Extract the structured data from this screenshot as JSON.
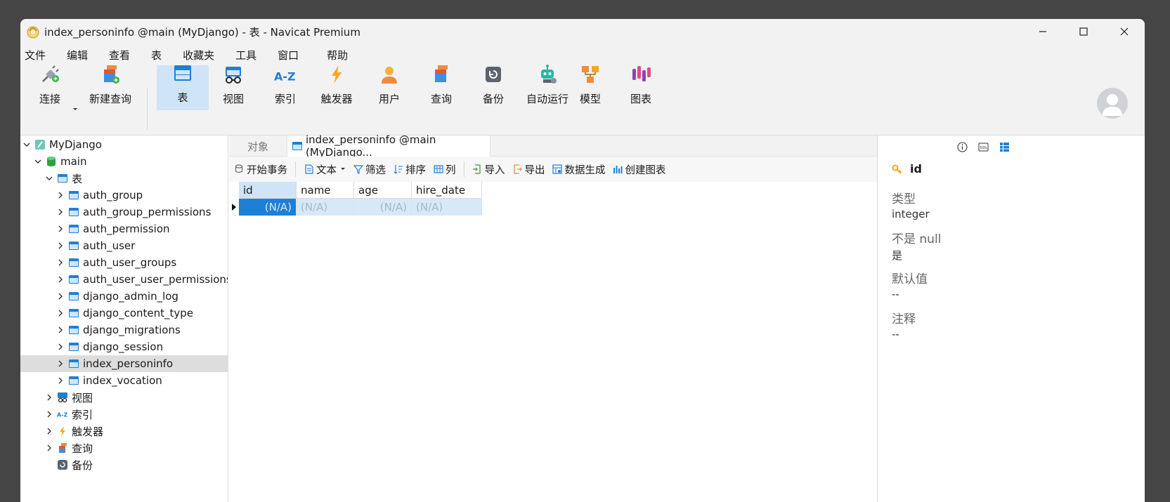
{
  "window": {
    "title": "index_personinfo @main (MyDjango) - 表 - Navicat Premium"
  },
  "menu": [
    "文件",
    "编辑",
    "查看",
    "表",
    "收藏夹",
    "工具",
    "窗口",
    "帮助"
  ],
  "toolbar": {
    "connect": "连接",
    "new_query": "新建查询",
    "table": "表",
    "view": "视图",
    "index": "索引",
    "trigger": "触发器",
    "user": "用户",
    "query": "查询",
    "backup": "备份",
    "automation": "自动运行",
    "model": "模型",
    "chart": "图表"
  },
  "tree": {
    "connection": "MyDjango",
    "database": "main",
    "tables_group": "表",
    "tables": [
      "auth_group",
      "auth_group_permissions",
      "auth_permission",
      "auth_user",
      "auth_user_groups",
      "auth_user_user_permissions",
      "django_admin_log",
      "django_content_type",
      "django_migrations",
      "django_session",
      "index_personinfo",
      "index_vocation"
    ],
    "selected_table": "index_personinfo",
    "views_group": "视图",
    "indexes_group": "索引",
    "triggers_group": "触发器",
    "queries_group": "查询",
    "backups_group": "备份"
  },
  "tabs": {
    "objects": "对象",
    "table_tab": "index_personinfo @main (MyDjango..."
  },
  "subtoolbar": {
    "begin_transaction": "开始事务",
    "text": "文本",
    "filter": "筛选",
    "sort": "排序",
    "columns": "列",
    "import": "导入",
    "export": "导出",
    "data_generation": "数据生成",
    "create_chart": "创建图表"
  },
  "grid": {
    "columns": [
      "id",
      "name",
      "age",
      "hire_date"
    ],
    "row": [
      "(N/A)",
      "(N/A)",
      "(N/A)",
      "(N/A)"
    ]
  },
  "field_panel": {
    "field_name": "id",
    "type_label": "类型",
    "type_value": "integer",
    "not_null_label": "不是 null",
    "not_null_value": "是",
    "default_label": "默认值",
    "default_value": "--",
    "comment_label": "注释",
    "comment_value": "--"
  },
  "colors": {
    "accent_blue": "#1e7fd8",
    "selection_blue": "#cfe4f7",
    "row_highlight": "#d7e8f8"
  }
}
